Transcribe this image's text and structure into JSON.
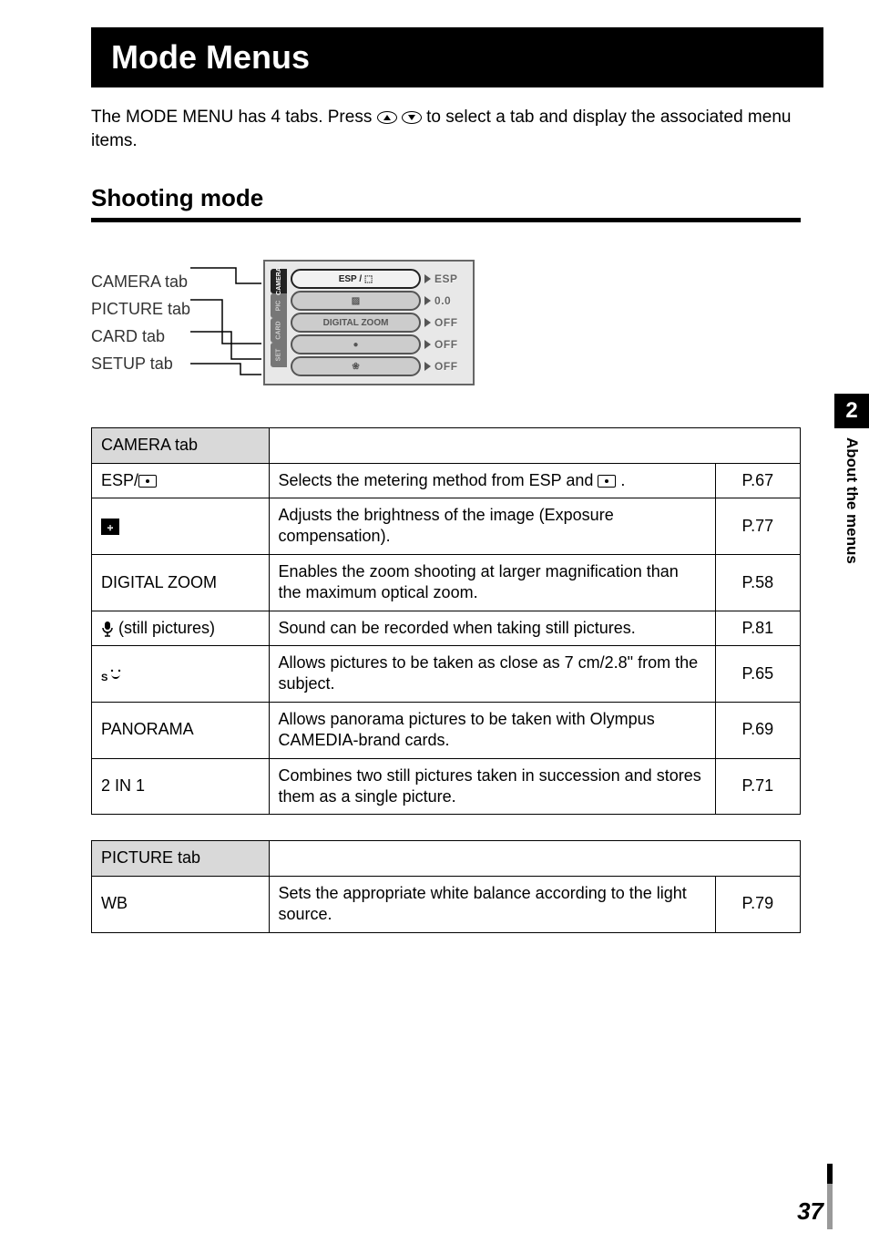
{
  "title": "Mode Menus",
  "intro_a": "The MODE MENU has 4 tabs. Press ",
  "intro_b": " to select a tab and display the associated menu items.",
  "section": "Shooting mode",
  "diagram": {
    "labels": [
      "CAMERA tab",
      "PICTURE tab",
      "CARD tab",
      "SETUP tab"
    ],
    "lcd_tabs": [
      "CAMERA",
      "PIC",
      "CARD",
      "SET"
    ],
    "rows": [
      {
        "pill": "ESP / ⬚",
        "val": "ESP",
        "active": true
      },
      {
        "pill": "▨",
        "val": "0.0"
      },
      {
        "pill": "DIGITAL ZOOM",
        "val": "OFF"
      },
      {
        "pill": "●",
        "val": "OFF"
      },
      {
        "pill": "❀",
        "val": "OFF"
      }
    ]
  },
  "camera_tab_label": "CAMERA tab",
  "camera_rows": [
    {
      "name": "ESP/",
      "desc_a": "Selects the metering method from ESP and ",
      "desc_b": " .",
      "page": "P.67",
      "has_spot_name": true,
      "has_spot_desc": true
    },
    {
      "name": "",
      "desc": "Adjusts the brightness of the image (Exposure compensation).",
      "page": "P.77",
      "exp_icon": true
    },
    {
      "name": "DIGITAL ZOOM",
      "desc": "Enables the zoom shooting at larger magnification than the maximum optical zoom.",
      "page": "P.58"
    },
    {
      "name": " (still pictures)",
      "desc": "Sound can be recorded when taking still pictures.",
      "page": "P.81",
      "mic_icon": true
    },
    {
      "name": "",
      "desc": "Allows pictures to be taken as close as 7 cm/2.8\" from the subject.",
      "page": "P.65",
      "macro_icon": true
    },
    {
      "name": "PANORAMA",
      "desc": "Allows panorama pictures to be taken with Olympus CAMEDIA-brand cards.",
      "page": "P.69"
    },
    {
      "name": "2 IN 1",
      "desc": "Combines two still pictures taken in succession and stores them as a single picture.",
      "page": "P.71"
    }
  ],
  "picture_tab_label": "PICTURE tab",
  "picture_rows": [
    {
      "name": "WB",
      "desc": "Sets the appropriate white balance according to the light source.",
      "page": "P.79"
    }
  ],
  "side": {
    "num": "2",
    "text": "About the menus"
  },
  "page_number": "37"
}
